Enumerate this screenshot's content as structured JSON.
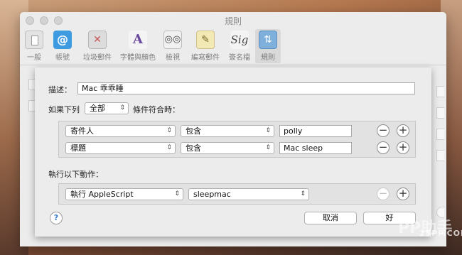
{
  "window": {
    "title": "規則"
  },
  "toolbar": {
    "items": [
      {
        "label": "一般",
        "icon": "general-icon"
      },
      {
        "label": "帳號",
        "icon": "accounts-icon",
        "glyph": "@"
      },
      {
        "label": "垃圾郵件",
        "icon": "junk-mail-icon",
        "glyph": "✕"
      },
      {
        "label": "字體與顏色",
        "icon": "fonts-colors-icon",
        "glyph": "A"
      },
      {
        "label": "檢視",
        "icon": "viewing-icon",
        "glyph": "◎◎"
      },
      {
        "label": "編寫郵件",
        "icon": "composing-icon",
        "glyph": "✎"
      },
      {
        "label": "簽名檔",
        "icon": "signatures-icon",
        "glyph": "Sig"
      },
      {
        "label": "規則",
        "icon": "rules-icon",
        "glyph": "⇅"
      }
    ]
  },
  "rule": {
    "description_label": "描述：",
    "description_value": "Mac 乖乖睡",
    "if_label": "如果下列",
    "match_value": "全部",
    "conditions_met_label": "條件符合時：",
    "conditions": [
      {
        "field": "寄件人",
        "operator": "包含",
        "value": "polly"
      },
      {
        "field": "標題",
        "operator": "包含",
        "value": "Mac sleep"
      }
    ],
    "actions_label": "執行以下動作：",
    "actions": [
      {
        "action": "執行 AppleScript",
        "target": "sleepmac"
      }
    ],
    "help_glyph": "?",
    "cancel_label": "取消",
    "ok_label": "好"
  },
  "icons": {
    "remove": "−",
    "add": "+",
    "chevron": "⌃⌄"
  },
  "watermark": {
    "brand": "PP助手",
    "domain": "25PP.COM"
  }
}
